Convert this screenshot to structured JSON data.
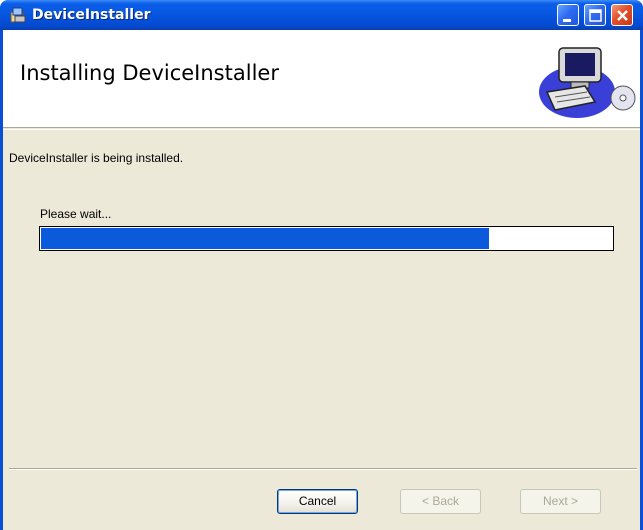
{
  "window": {
    "title": "DeviceInstaller",
    "colors": {
      "titlebar": "#0756e0",
      "close": "#e2502a",
      "progress": "#0a5adb",
      "face": "#ece9d8"
    }
  },
  "banner": {
    "title": "Installing DeviceInstaller",
    "art_icon": "computer-cd-icon"
  },
  "body": {
    "status": "DeviceInstaller is being installed.",
    "wait_label": "Please wait...",
    "progress_fraction": 0.785
  },
  "buttons": {
    "cancel": "Cancel",
    "back": "< Back",
    "next": "Next >"
  },
  "icons": [
    "installer-app-icon",
    "minimize-icon",
    "maximize-icon",
    "close-icon",
    "computer-cd-icon"
  ]
}
